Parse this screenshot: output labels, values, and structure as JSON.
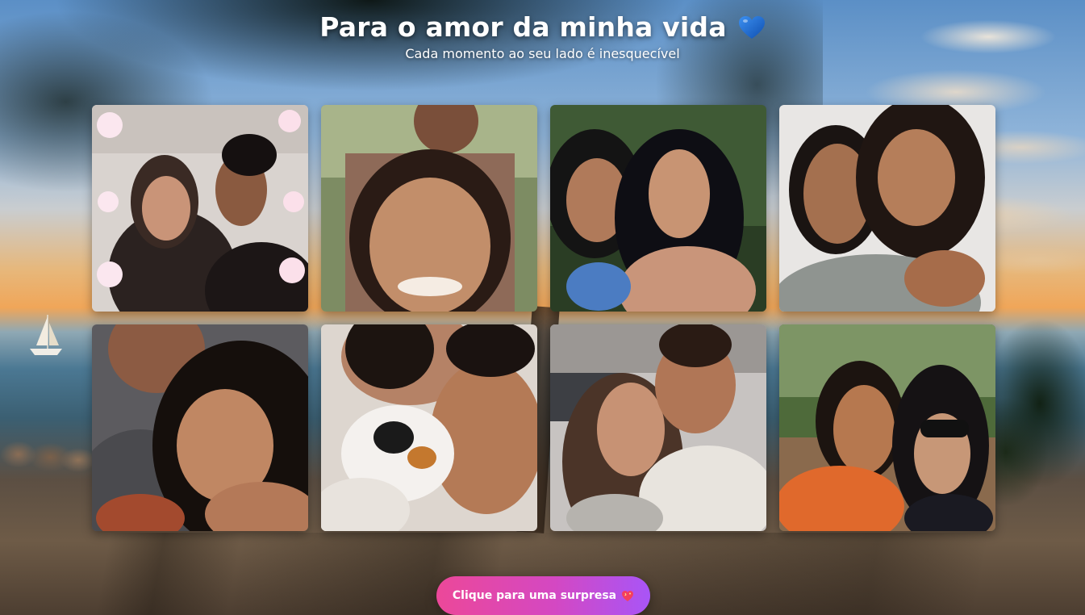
{
  "header": {
    "title": "Para o amor da minha vida",
    "title_icon": "blue-heart-icon",
    "subtitle": "Cada momento ao seu lado é inesquecível"
  },
  "gallery": {
    "photos": [
      {
        "name": "photo-1",
        "icon": "couple-photo"
      },
      {
        "name": "photo-2",
        "icon": "couple-photo"
      },
      {
        "name": "photo-3",
        "icon": "couple-photo"
      },
      {
        "name": "photo-4",
        "icon": "couple-photo"
      },
      {
        "name": "photo-5",
        "icon": "couple-photo"
      },
      {
        "name": "photo-6",
        "icon": "couple-photo"
      },
      {
        "name": "photo-7",
        "icon": "couple-photo"
      },
      {
        "name": "photo-8",
        "icon": "couple-photo"
      }
    ]
  },
  "surprise_button": {
    "label": "Clique para uma surpresa",
    "icon": "sparkling-heart-icon"
  },
  "colors": {
    "accent_start": "#ec4899",
    "accent_end": "#a855f7",
    "heart": "#1f6fd6"
  }
}
